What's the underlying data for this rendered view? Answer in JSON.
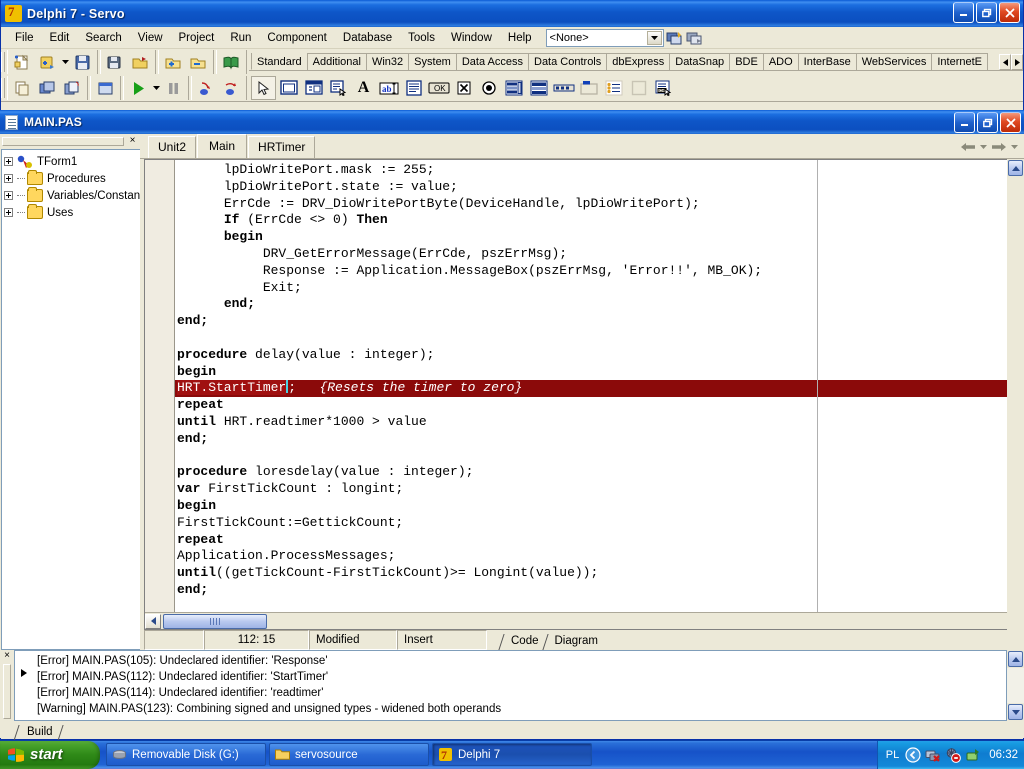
{
  "window": {
    "title": "Delphi 7 - Servo",
    "logo_icon": "delphi-logo-icon",
    "minimize_label": "Minimize",
    "maximize_label": "Restore",
    "close_label": "Close"
  },
  "menu": {
    "items": [
      "File",
      "Edit",
      "Search",
      "View",
      "Project",
      "Run",
      "Component",
      "Database",
      "Tools",
      "Window",
      "Help"
    ],
    "project_combo_value": "<None>",
    "project_combo_arrow_icon": "chevron-down-icon"
  },
  "toolbar": {
    "row1": [
      {
        "name": "new-item-button",
        "icon": "new-file-icon"
      },
      {
        "name": "open-project-button",
        "icon": "open-project-icon"
      },
      {
        "name": "open-project-dropdown",
        "icon": "chevron-down-icon"
      },
      {
        "name": "save-button",
        "icon": "save-icon"
      },
      {
        "name": "save-all-button",
        "icon": "save-all-icon"
      },
      {
        "name": "open-button",
        "icon": "open-folder-icon"
      },
      {
        "name": "add-file-to-project-button",
        "icon": "add-file-icon"
      },
      {
        "name": "remove-file-from-project-button",
        "icon": "remove-file-icon"
      },
      {
        "name": "help-button",
        "icon": "help-book-icon"
      }
    ],
    "row2": [
      {
        "name": "view-unit-button",
        "icon": "view-unit-icon"
      },
      {
        "name": "view-form-button",
        "icon": "view-form-icon"
      },
      {
        "name": "toggle-form-unit-button",
        "icon": "toggle-form-unit-icon"
      },
      {
        "name": "new-form-button",
        "icon": "new-form-icon"
      },
      {
        "name": "run-button",
        "icon": "run-play-icon"
      },
      {
        "name": "run-dropdown",
        "icon": "chevron-down-icon"
      },
      {
        "name": "pause-button",
        "icon": "pause-icon"
      },
      {
        "name": "trace-into-button",
        "icon": "trace-into-icon"
      },
      {
        "name": "step-over-button",
        "icon": "step-over-icon"
      }
    ]
  },
  "palette": {
    "tabs": [
      "Standard",
      "Additional",
      "Win32",
      "System",
      "Data Access",
      "Data Controls",
      "dbExpress",
      "DataSnap",
      "BDE",
      "ADO",
      "InterBase",
      "WebServices",
      "InternetE"
    ],
    "active_tab": "Standard",
    "scroll_left_icon": "triangle-left-icon",
    "scroll_right_icon": "triangle-right-icon",
    "components": [
      {
        "name": "palette-pointer",
        "icon": "pointer-arrow-icon",
        "selected": true
      },
      {
        "name": "palette-frames",
        "icon": "frames-icon",
        "selected": false
      },
      {
        "name": "palette-mainmenu",
        "icon": "main-menu-icon",
        "selected": false
      },
      {
        "name": "palette-popupmenu",
        "icon": "popup-menu-icon",
        "selected": false
      },
      {
        "name": "palette-label",
        "icon": "label-A-icon",
        "selected": false
      },
      {
        "name": "palette-edit",
        "icon": "edit-box-icon",
        "selected": false
      },
      {
        "name": "palette-memo",
        "icon": "memo-icon",
        "selected": false
      },
      {
        "name": "palette-button",
        "icon": "ok-button-icon",
        "selected": false
      },
      {
        "name": "palette-checkbox",
        "icon": "checkbox-icon",
        "selected": false
      },
      {
        "name": "palette-radiobutton",
        "icon": "radio-button-icon",
        "selected": false
      },
      {
        "name": "palette-listbox",
        "icon": "list-box-icon",
        "selected": false
      },
      {
        "name": "palette-combobox",
        "icon": "combo-box-icon",
        "selected": false
      },
      {
        "name": "palette-scrollbar",
        "icon": "scroll-bar-icon",
        "selected": false
      },
      {
        "name": "palette-groupbox",
        "icon": "group-box-icon",
        "selected": false
      },
      {
        "name": "palette-radiogroup",
        "icon": "radio-group-icon",
        "selected": false
      },
      {
        "name": "palette-panel",
        "icon": "panel-icon",
        "selected": false
      },
      {
        "name": "palette-actionlist",
        "icon": "action-list-icon",
        "selected": false
      }
    ]
  },
  "editor_window": {
    "title": "MAIN.PAS",
    "file_icon": "pascal-file-icon",
    "minimize_label": "Minimize",
    "maximize_label": "Restore",
    "close_label": "Close"
  },
  "code_explorer": {
    "close_icon": "close-x-icon",
    "items": [
      {
        "label": "TForm1",
        "icon": "form-class-icon",
        "expander": "plus-icon"
      },
      {
        "label": "Procedures",
        "icon": "folder-icon",
        "expander": "plus-icon"
      },
      {
        "label": "Variables/Constants",
        "icon": "folder-icon",
        "expander": "plus-icon"
      },
      {
        "label": "Uses",
        "icon": "folder-icon",
        "expander": "plus-icon"
      }
    ]
  },
  "editor": {
    "tabs": [
      "Unit2",
      "Main",
      "HRTimer"
    ],
    "active_tab": "Main",
    "nav_back_icon": "arrow-left-icon",
    "nav_back_caret_icon": "chevron-down-icon",
    "nav_forward_icon": "arrow-right-icon",
    "nav_forward_caret_icon": "chevron-down-icon",
    "highlight_color": "#8b0a0a",
    "selection_color": "#a01010",
    "gutter_color": "#f0ece1",
    "lines": [
      {
        "indent": 6,
        "segments": [
          {
            "t": "lpDioWritePort.mask := 255;",
            "s": "plain"
          }
        ]
      },
      {
        "indent": 6,
        "segments": [
          {
            "t": "lpDioWritePort.state := value;",
            "s": "plain"
          }
        ]
      },
      {
        "indent": 6,
        "segments": [
          {
            "t": "ErrCde := DRV_DioWritePortByte(DeviceHandle, lpDioWritePort);",
            "s": "plain"
          }
        ]
      },
      {
        "indent": 6,
        "segments": [
          {
            "t": "If",
            "s": "kw"
          },
          {
            "t": " (ErrCde <> 0) ",
            "s": "plain"
          },
          {
            "t": "Then",
            "s": "kw"
          }
        ]
      },
      {
        "indent": 6,
        "segments": [
          {
            "t": "begin",
            "s": "kw"
          }
        ]
      },
      {
        "indent": 11,
        "segments": [
          {
            "t": "DRV_GetErrorMessage(ErrCde, pszErrMsg);",
            "s": "plain"
          }
        ]
      },
      {
        "indent": 11,
        "segments": [
          {
            "t": "Response := Application.MessageBox(pszErrMsg, 'Error!!', MB_OK);",
            "s": "plain"
          }
        ]
      },
      {
        "indent": 11,
        "segments": [
          {
            "t": "Exit;",
            "s": "plain"
          }
        ]
      },
      {
        "indent": 6,
        "segments": [
          {
            "t": "end;",
            "s": "kw"
          }
        ]
      },
      {
        "indent": 0,
        "segments": [
          {
            "t": "end;",
            "s": "kw"
          }
        ]
      },
      {
        "indent": 0,
        "segments": []
      },
      {
        "indent": 0,
        "segments": [
          {
            "t": "procedure",
            "s": "kw"
          },
          {
            "t": " delay(value : integer);",
            "s": "plain"
          }
        ]
      },
      {
        "indent": 0,
        "segments": [
          {
            "t": "begin",
            "s": "kw"
          }
        ]
      },
      {
        "indent": 0,
        "highlighted": true,
        "segments": [
          {
            "t": "HRT.StartTimer",
            "s": "sel"
          },
          {
            "t": "|",
            "s": "caret"
          },
          {
            "t": ";   ",
            "s": "plain"
          },
          {
            "t": "{Resets the timer to zero}",
            "s": "cmt"
          }
        ]
      },
      {
        "indent": 0,
        "segments": [
          {
            "t": "repeat",
            "s": "kw"
          }
        ]
      },
      {
        "indent": 0,
        "segments": [
          {
            "t": "until",
            "s": "kw"
          },
          {
            "t": " HRT.readtimer*1000 > value",
            "s": "plain"
          }
        ]
      },
      {
        "indent": 0,
        "segments": [
          {
            "t": "end;",
            "s": "kw"
          }
        ]
      },
      {
        "indent": 0,
        "segments": []
      },
      {
        "indent": 0,
        "segments": [
          {
            "t": "procedure",
            "s": "kw"
          },
          {
            "t": " loresdelay(value : integer);",
            "s": "plain"
          }
        ]
      },
      {
        "indent": 0,
        "segments": [
          {
            "t": "var",
            "s": "kw"
          },
          {
            "t": " FirstTickCount : longint;",
            "s": "plain"
          }
        ]
      },
      {
        "indent": 0,
        "segments": [
          {
            "t": "begin",
            "s": "kw"
          }
        ]
      },
      {
        "indent": 0,
        "segments": [
          {
            "t": "FirstTickCount:=GettickCount;",
            "s": "plain"
          }
        ]
      },
      {
        "indent": 0,
        "segments": [
          {
            "t": "repeat",
            "s": "kw"
          }
        ]
      },
      {
        "indent": 0,
        "segments": [
          {
            "t": "Application.ProcessMessages;",
            "s": "plain"
          }
        ]
      },
      {
        "indent": 0,
        "segments": [
          {
            "t": "until",
            "s": "kw"
          },
          {
            "t": "((getTickCount-FirstTickCount)>= Longint(value));",
            "s": "plain"
          }
        ]
      },
      {
        "indent": 0,
        "segments": [
          {
            "t": "end;",
            "s": "kw"
          }
        ]
      }
    ],
    "hscroll_left_icon": "triangle-left-icon",
    "vscroll_up_icon": "triangle-up-icon"
  },
  "editor_status": {
    "cursor_position": "112: 15",
    "modified": "Modified",
    "insert_mode": "Insert",
    "view_tabs": [
      "Code",
      "Diagram"
    ],
    "active_view_tab": "Code"
  },
  "messages": {
    "close_icon": "close-x-icon",
    "current_marker_icon": "triangle-right-icon",
    "items": [
      "[Error] MAIN.PAS(105): Undeclared identifier: 'Response'",
      "[Error] MAIN.PAS(112): Undeclared identifier: 'StartTimer'",
      "[Error] MAIN.PAS(114): Undeclared identifier: 'readtimer'",
      "[Warning] MAIN.PAS(123): Combining signed and unsigned types - widened both operands"
    ],
    "selected_index": 1,
    "tabs": [
      "Build"
    ],
    "active_tab": "Build",
    "scroll_up_icon": "triangle-up-icon",
    "scroll_down_icon": "triangle-down-icon"
  },
  "taskbar": {
    "start_label": "start",
    "start_icon": "windows-flag-icon",
    "tasks": [
      {
        "label": "Removable Disk (G:)",
        "icon": "removable-disk-icon",
        "active": false
      },
      {
        "label": "servosource",
        "icon": "folder-icon",
        "active": false
      },
      {
        "label": "Delphi 7",
        "icon": "delphi-logo-icon",
        "active": true
      }
    ],
    "tray": {
      "language": "PL",
      "icons": [
        "show-hidden-icons-icon",
        "network-disconnected-icon",
        "antivirus-alert-icon",
        "safely-remove-hardware-icon"
      ],
      "clock": "06:32"
    }
  }
}
